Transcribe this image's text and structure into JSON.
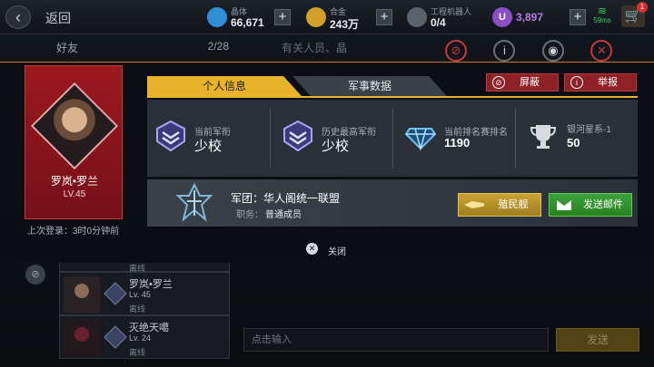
{
  "topbar": {
    "back_label": "返回",
    "resources": [
      {
        "name": "crystal",
        "label": "晶体",
        "value": "66,671",
        "icon": "crystal-icon",
        "color": "#2f8fd6"
      },
      {
        "name": "alloy",
        "label": "合金",
        "value": "243万",
        "icon": "alloy-icon",
        "color": "#d3a12a"
      },
      {
        "name": "robots",
        "label": "工程机器人",
        "value": "0/4",
        "icon": "robot-icon",
        "color": "#9aa2ab"
      },
      {
        "name": "u-coin",
        "label": "",
        "value": "3,897",
        "icon": "u-coin-icon",
        "color": "#8a4fc9"
      }
    ],
    "ping": "59ms",
    "cart_badge": "1"
  },
  "background": {
    "friends_title": "好友",
    "friends_count": "2/28",
    "right_title": "有关人员、晶",
    "friends": [
      {
        "name": "罗岚•罗兰",
        "level": "Lv. 45",
        "status": "离线"
      },
      {
        "name": "灭绝天噶",
        "level": "Lv. 24",
        "status": "离线"
      }
    ],
    "partial_status": "离线",
    "chat_placeholder": "点击输入",
    "send_label": "发送"
  },
  "profile": {
    "name": "罗岚•罗兰",
    "level": "LV.45",
    "last_login": "上次登录：3时0分钟前",
    "tabs": [
      {
        "label": "个人信息",
        "active": true
      },
      {
        "label": "军事数据",
        "active": false
      }
    ],
    "actions": {
      "block_label": "屏蔽",
      "report_label": "举报"
    },
    "stats": [
      {
        "label": "当前军衔",
        "value": "少校",
        "icon": "rank-badge-icon"
      },
      {
        "label": "历史最高军衔",
        "value": "少校",
        "icon": "rank-badge-icon"
      },
      {
        "label": "当前排名赛排名",
        "value": "1190",
        "icon": "diamond-trophy-icon"
      },
      {
        "label": "银河星系-1",
        "value": "50",
        "icon": "trophy-icon"
      }
    ],
    "legion": {
      "name": "军团：华人阁统一联盟",
      "role_label": "职务：",
      "role": "普通成员",
      "colony_label": "殖民舰",
      "mail_label": "发送邮件"
    },
    "close_label": "关闭"
  },
  "colors": {
    "accent_gold": "#e7b32a",
    "card_red": "#8e1820",
    "mail_green": "#3da23b"
  }
}
